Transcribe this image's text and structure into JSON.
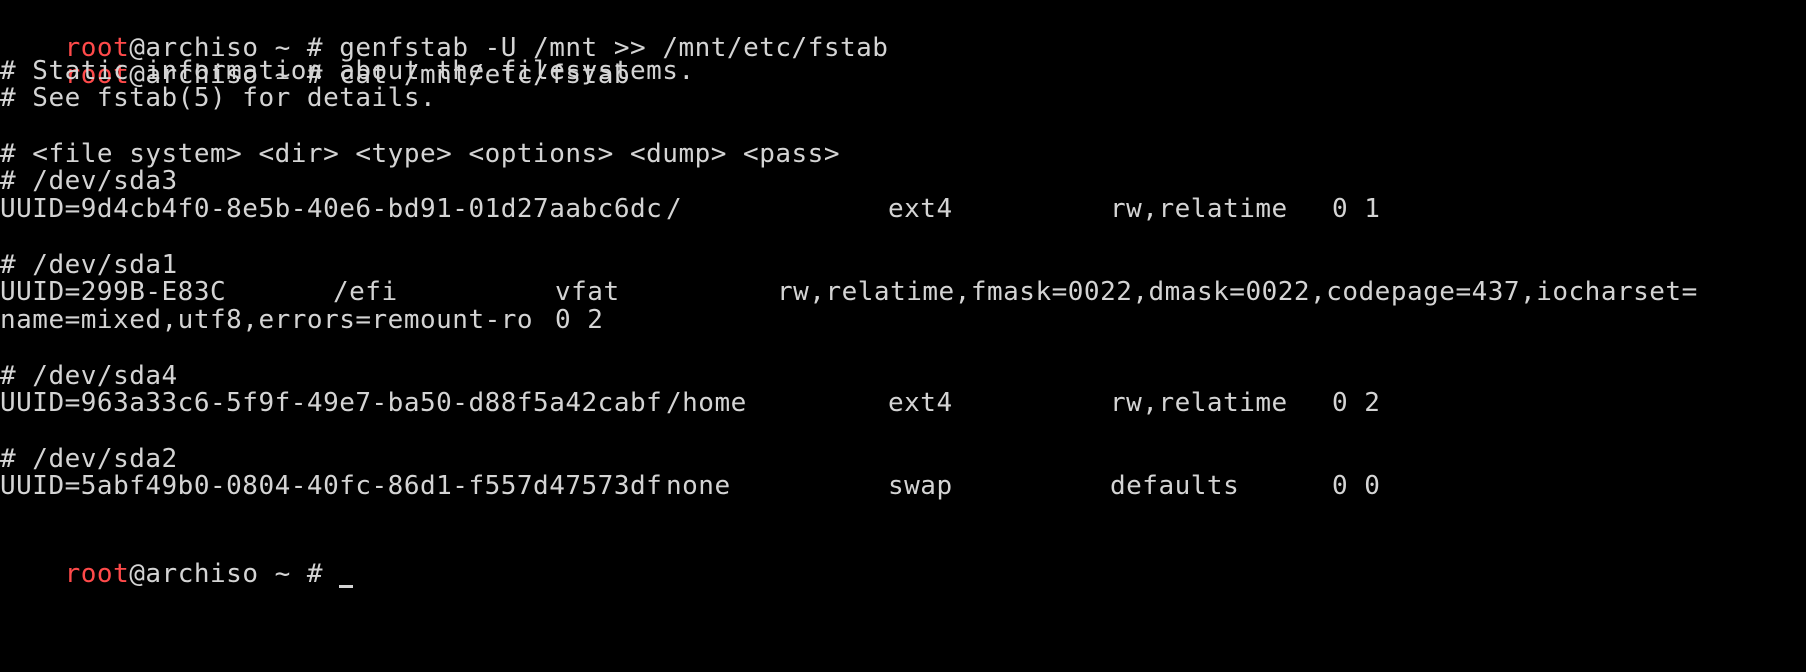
{
  "prompt": {
    "user": "root",
    "host_sep": "@archiso ~ # "
  },
  "commands": {
    "genfstab": "genfstab -U /mnt >> /mnt/etc/fstab",
    "cat": "cat /mnt/etc/fstab"
  },
  "fstab": {
    "comment_1": "# Static information about the filesystems.",
    "comment_2": "# See fstab(5) for details.",
    "header": "# <file system> <dir> <type> <options> <dump> <pass>",
    "entries": [
      {
        "device_comment": "# /dev/sda3",
        "uuid": "UUID=9d4cb4f0-8e5b-40e6-bd91-01d27aabc6dc",
        "dir": "/",
        "type": "ext4",
        "options": "rw,relatime",
        "dump_pass": "0 1"
      },
      {
        "device_comment": "# /dev/sda1",
        "uuid": "UUID=299B-E83C",
        "dir": "/efi",
        "type": "vfat",
        "options": "rw,relatime,fmask=0022,dmask=0022,codepage=437,iocharset=",
        "options_cont": "name=mixed,utf8,errors=remount-ro",
        "dump_pass": "0 2"
      },
      {
        "device_comment": "# /dev/sda4",
        "uuid": "UUID=963a33c6-5f9f-49e7-ba50-d88f5a42cabf",
        "dir": "/home",
        "type": "ext4",
        "options": "rw,relatime",
        "dump_pass": "0 2"
      },
      {
        "device_comment": "# /dev/sda2",
        "uuid": "UUID=5abf49b0-0804-40fc-86d1-f557d47573df",
        "dir": "none",
        "type": "swap",
        "options": "defaults",
        "dump_pass": "0 0"
      }
    ]
  },
  "colors": {
    "background": "#000000",
    "text": "#d4d4d4",
    "user": "#ff4a4a"
  }
}
